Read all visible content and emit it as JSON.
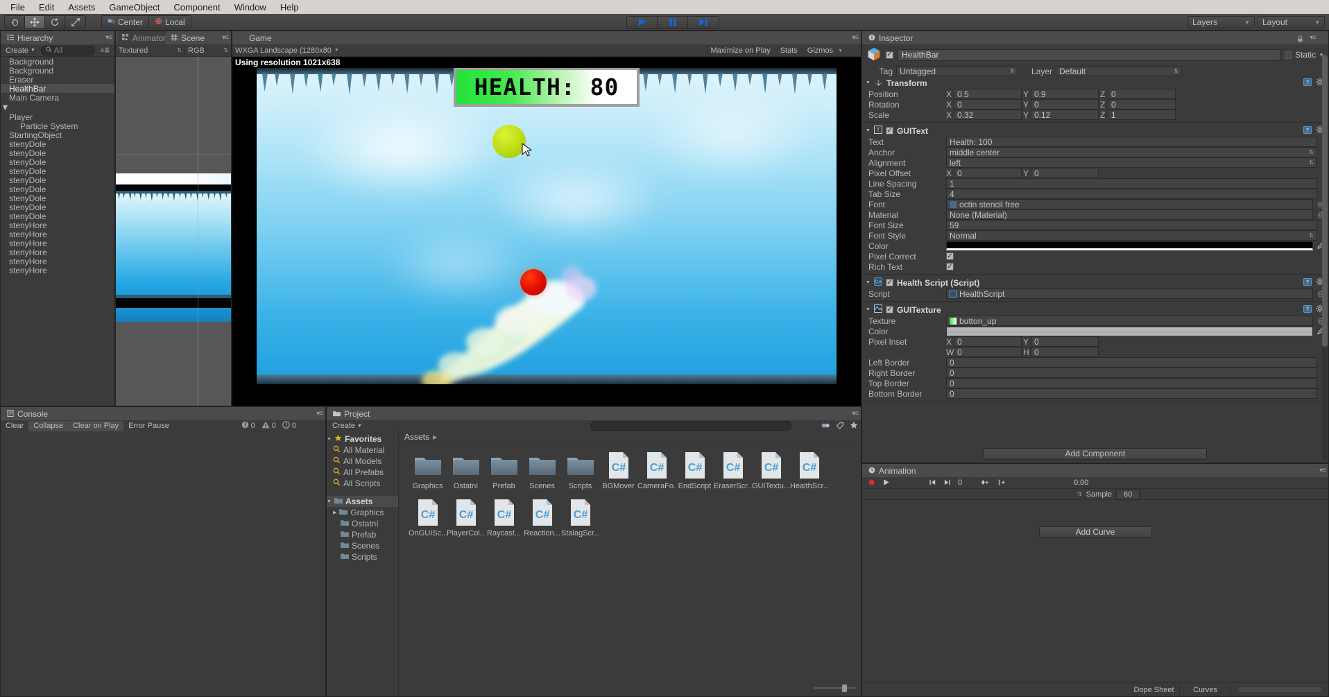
{
  "menubar": {
    "items": [
      "File",
      "Edit",
      "Assets",
      "GameObject",
      "Component",
      "Window",
      "Help"
    ]
  },
  "toolbar": {
    "tools": [
      "hand-tool",
      "move-tool",
      "rotate-tool",
      "scale-tool"
    ],
    "selected_tool": "move-tool",
    "pivot_mode": "Center",
    "pivot_rotation": "Local",
    "play": "play-button",
    "pause": "pause-button",
    "step": "step-button",
    "layers_label": "Layers",
    "layout_label": "Layout"
  },
  "hierarchy": {
    "tab": "Hierarchy",
    "create_label": "Create",
    "search_placeholder": "All",
    "items": [
      {
        "name": "Background",
        "indent": 0,
        "expandable": false,
        "selected": false
      },
      {
        "name": "Background",
        "indent": 0,
        "expandable": false,
        "selected": false
      },
      {
        "name": "Eraser",
        "indent": 0,
        "expandable": false,
        "selected": false
      },
      {
        "name": "HealthBar",
        "indent": 0,
        "expandable": false,
        "selected": true
      },
      {
        "name": "Main Camera",
        "indent": 0,
        "expandable": false,
        "selected": false
      },
      {
        "name": "Player",
        "indent": 0,
        "expandable": true,
        "selected": false
      },
      {
        "name": "Particle System",
        "indent": 1,
        "expandable": false,
        "selected": false
      },
      {
        "name": "StartingObject",
        "indent": 0,
        "expandable": false,
        "selected": false
      },
      {
        "name": "stenyDole",
        "indent": 0,
        "expandable": false,
        "selected": false
      },
      {
        "name": "stenyDole",
        "indent": 0,
        "expandable": false,
        "selected": false
      },
      {
        "name": "stenyDole",
        "indent": 0,
        "expandable": false,
        "selected": false
      },
      {
        "name": "stenyDole",
        "indent": 0,
        "expandable": false,
        "selected": false
      },
      {
        "name": "stenyDole",
        "indent": 0,
        "expandable": false,
        "selected": false
      },
      {
        "name": "stenyDole",
        "indent": 0,
        "expandable": false,
        "selected": false
      },
      {
        "name": "stenyDole",
        "indent": 0,
        "expandable": false,
        "selected": false
      },
      {
        "name": "stenyDole",
        "indent": 0,
        "expandable": false,
        "selected": false
      },
      {
        "name": "stenyDole",
        "indent": 0,
        "expandable": false,
        "selected": false
      },
      {
        "name": "stenyHore",
        "indent": 0,
        "expandable": false,
        "selected": false
      },
      {
        "name": "stenyHore",
        "indent": 0,
        "expandable": false,
        "selected": false
      },
      {
        "name": "stenyHore",
        "indent": 0,
        "expandable": false,
        "selected": false
      },
      {
        "name": "stenyHore",
        "indent": 0,
        "expandable": false,
        "selected": false
      },
      {
        "name": "stenyHore",
        "indent": 0,
        "expandable": false,
        "selected": false
      },
      {
        "name": "stenyHore",
        "indent": 0,
        "expandable": false,
        "selected": false
      }
    ]
  },
  "scene_panel": {
    "tabs": [
      {
        "label": "Animator",
        "active": false
      },
      {
        "label": "Scene",
        "active": true
      }
    ],
    "draw_mode": "Textured",
    "color_mode": "RGB"
  },
  "game_panel": {
    "tab": "Game",
    "aspect": "WXGA Landscape (1280x80",
    "resolution_text": "Using resolution 1021x638",
    "maximize_on_play": "Maximize on Play",
    "stats": "Stats",
    "gizmos": "Gizmos",
    "hud": {
      "health_text": "HEALTH: 80",
      "bar_fill_color": "#2ce43c"
    }
  },
  "console": {
    "tab": "Console",
    "buttons": [
      "Clear",
      "Collapse",
      "Clear on Play",
      "Error Pause"
    ],
    "counts": {
      "log": "0",
      "warning": "0",
      "error": "0"
    }
  },
  "project": {
    "tab": "Project",
    "create_label": "Create",
    "favorites_label": "Favorites",
    "favorites": [
      "All Material",
      "All Models",
      "All Prefabs",
      "All Scripts"
    ],
    "assets_label": "Assets",
    "tree": [
      "Graphics",
      "Ostatní",
      "Prefab",
      "Scenes",
      "Scripts"
    ],
    "breadcrumb": "Assets",
    "items": [
      {
        "label": "Graphics",
        "type": "folder"
      },
      {
        "label": "Ostatní",
        "type": "folder"
      },
      {
        "label": "Prefab",
        "type": "folder"
      },
      {
        "label": "Scenes",
        "type": "folder"
      },
      {
        "label": "Scripts",
        "type": "folder"
      },
      {
        "label": "BGMover",
        "type": "csharp"
      },
      {
        "label": "CameraFo...",
        "type": "csharp"
      },
      {
        "label": "EndScript",
        "type": "csharp"
      },
      {
        "label": "EraserScr...",
        "type": "csharp"
      },
      {
        "label": "GUITextu...",
        "type": "csharp"
      },
      {
        "label": "HealthScr...",
        "type": "csharp"
      },
      {
        "label": "OnGUISc...",
        "type": "csharp"
      },
      {
        "label": "PlayerCol...",
        "type": "csharp"
      },
      {
        "label": "Raycast...",
        "type": "csharp"
      },
      {
        "label": "Reaction...",
        "type": "csharp"
      },
      {
        "label": "StalagScr...",
        "type": "csharp"
      }
    ]
  },
  "inspector": {
    "tab": "Inspector",
    "object_name": "HealthBar",
    "object_enabled": true,
    "static_label": "Static",
    "tag_label": "Tag",
    "tag_value": "Untagged",
    "layer_label": "Layer",
    "layer_value": "Default",
    "components": [
      {
        "title": "Transform",
        "icon": "transform-icon",
        "has_checkbox": false,
        "rows": [
          {
            "label": "Position",
            "type": "vector3",
            "x": "0.5",
            "y": "0.9",
            "z": "0"
          },
          {
            "label": "Rotation",
            "type": "vector3",
            "x": "0",
            "y": "0",
            "z": "0"
          },
          {
            "label": "Scale",
            "type": "vector3",
            "x": "0.32",
            "y": "0.12",
            "z": "1"
          }
        ]
      },
      {
        "title": "GUIText",
        "icon": "text-icon",
        "has_checkbox": true,
        "enabled": true,
        "rows": [
          {
            "label": "Text",
            "type": "text",
            "value": "Health: 100"
          },
          {
            "label": "Anchor",
            "type": "dropdown",
            "value": "middle center"
          },
          {
            "label": "Alignment",
            "type": "dropdown",
            "value": "left"
          },
          {
            "label": "Pixel Offset",
            "type": "vector2",
            "x": "0",
            "y": "0"
          },
          {
            "label": "Line Spacing",
            "type": "text",
            "value": "1"
          },
          {
            "label": "Tab Size",
            "type": "text",
            "value": "4"
          },
          {
            "label": "Font",
            "type": "object",
            "value": "octin stencil free"
          },
          {
            "label": "Material",
            "type": "object",
            "value": "None (Material)"
          },
          {
            "label": "Font Size",
            "type": "text",
            "value": "59"
          },
          {
            "label": "Font Style",
            "type": "dropdown",
            "value": "Normal"
          },
          {
            "label": "Color",
            "type": "color",
            "value": "#000000"
          },
          {
            "label": "Pixel Correct",
            "type": "checkbox",
            "checked": true
          },
          {
            "label": "Rich Text",
            "type": "checkbox",
            "checked": true
          }
        ]
      },
      {
        "title": "Health Script (Script)",
        "icon": "script-icon",
        "has_checkbox": true,
        "enabled": true,
        "rows": [
          {
            "label": "Script",
            "type": "object",
            "value": "HealthScript"
          }
        ]
      },
      {
        "title": "GUITexture",
        "icon": "texture-icon",
        "has_checkbox": true,
        "enabled": true,
        "rows": [
          {
            "label": "Texture",
            "type": "object",
            "value": "button_up"
          },
          {
            "label": "Color",
            "type": "color",
            "value": "#b4b4b4"
          },
          {
            "label": "Pixel Inset",
            "type": "vector2",
            "x": "0",
            "y": "0"
          },
          {
            "label": "Pixel Inset WH",
            "type": "vector2wh",
            "w": "0",
            "h": "0"
          },
          {
            "label": "Left Border",
            "type": "text",
            "value": "0"
          },
          {
            "label": "Right Border",
            "type": "text",
            "value": "0"
          },
          {
            "label": "Top Border",
            "type": "text",
            "value": "0"
          },
          {
            "label": "Bottom Border",
            "type": "text",
            "value": "0"
          }
        ]
      }
    ],
    "add_component_label": "Add Component"
  },
  "animation": {
    "tab": "Animation",
    "frame_value": "0",
    "sample_label": "Sample",
    "sample_value": "60",
    "time_label": "0:00",
    "add_curve_label": "Add Curve",
    "footer_tabs": [
      "Dope Sheet",
      "Curves"
    ]
  }
}
